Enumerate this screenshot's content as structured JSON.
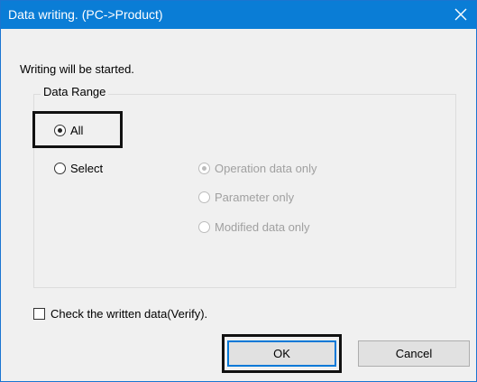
{
  "window": {
    "title": "Data writing. (PC->Product)",
    "close_icon": "close-icon"
  },
  "message": "Writing will be started.",
  "data_range": {
    "label": "Data Range",
    "all_label": "All",
    "all_checked": true,
    "select_label": "Select",
    "select_checked": false,
    "sub_options": [
      {
        "label": "Operation data only",
        "checked": true,
        "enabled": false
      },
      {
        "label": "Parameter only",
        "checked": false,
        "enabled": false
      },
      {
        "label": "Modified data only",
        "checked": false,
        "enabled": false
      }
    ]
  },
  "verify": {
    "label": "Check the written data(Verify).",
    "checked": false
  },
  "buttons": {
    "ok_label": "OK",
    "cancel_label": "Cancel"
  },
  "colors": {
    "title_bar": "#0a7dd6",
    "dialog_bg": "#f0f0f0",
    "highlight_border": "#111111",
    "default_button_border": "#0078d7"
  }
}
